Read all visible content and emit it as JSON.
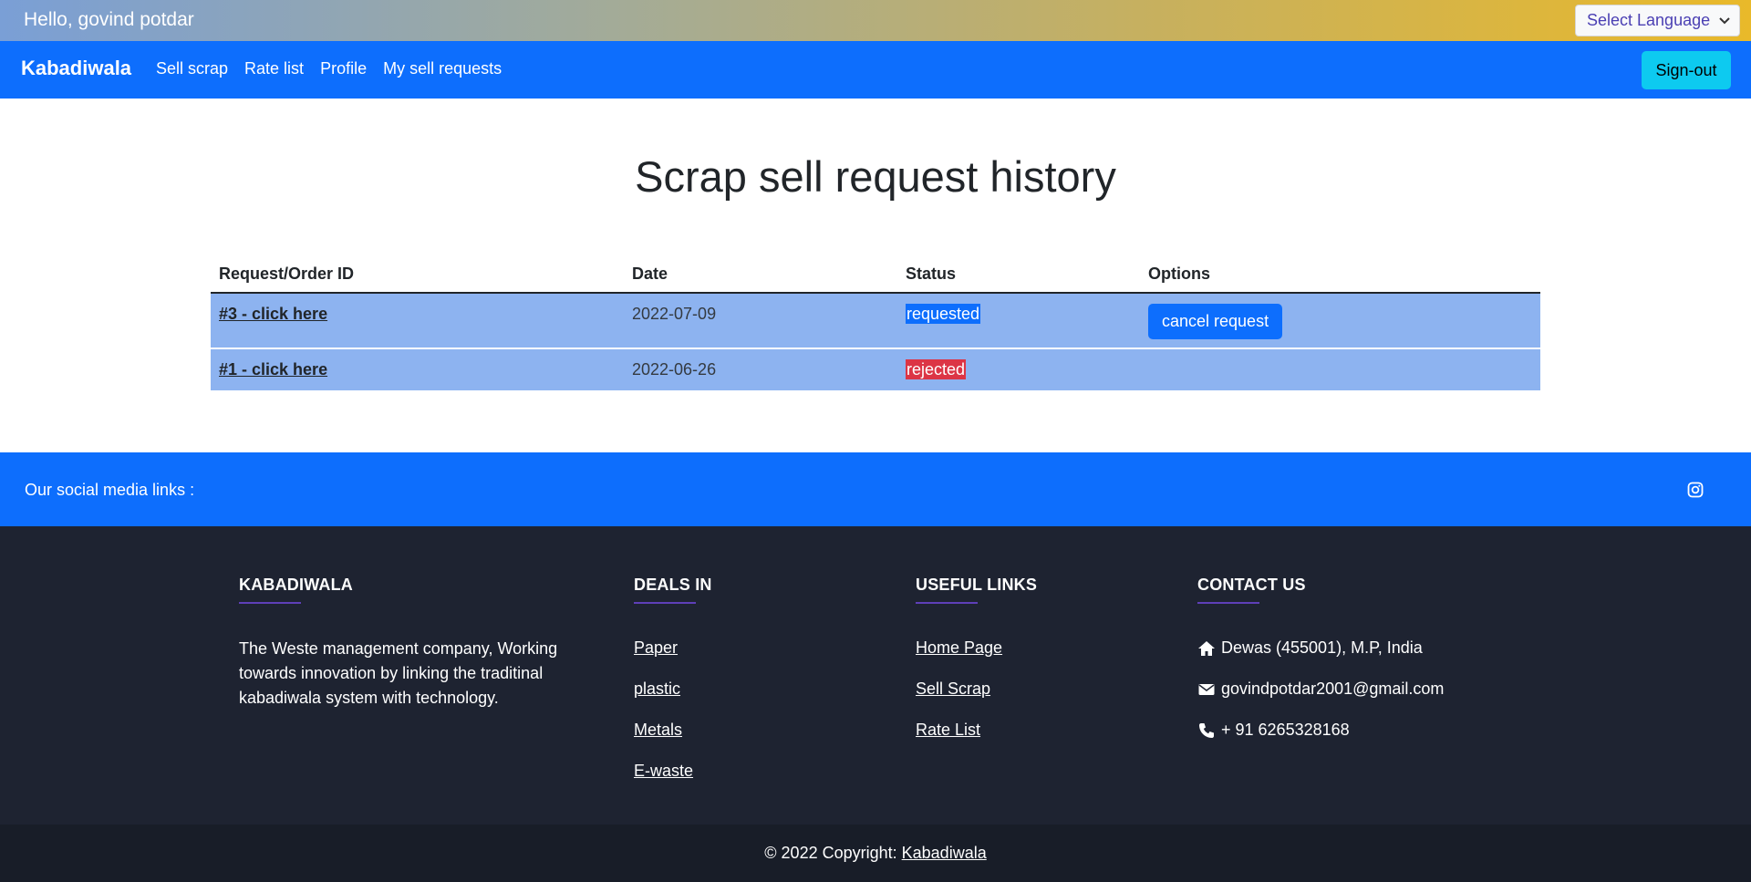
{
  "greeting": "Hello, govind potdar",
  "language_select": {
    "value": "Select Language"
  },
  "navbar": {
    "brand": "Kabadiwala",
    "links": [
      "Sell scrap",
      "Rate list",
      "Profile",
      "My sell requests"
    ],
    "signout_label": "Sign-out"
  },
  "main": {
    "title": "Scrap sell request history",
    "table": {
      "headers": [
        "Request/Order ID",
        "Date",
        "Status",
        "Options"
      ],
      "rows": [
        {
          "id": "#3 - click here",
          "date": "2022-07-09",
          "status": "requested",
          "option": "cancel request"
        },
        {
          "id": "#1 - click here",
          "date": "2022-06-26",
          "status": "rejected",
          "option": ""
        }
      ]
    }
  },
  "social": {
    "label": "Our social media links :",
    "icons": [
      "instagram-icon"
    ]
  },
  "footer": {
    "about": {
      "heading": "KABADIWALA",
      "text": "The Weste management company, Working towards innovation by linking the traditinal kabadiwala system with technology."
    },
    "deals": {
      "heading": "DEALS IN",
      "items": [
        "Paper",
        "plastic",
        "Metals",
        "E-waste"
      ]
    },
    "useful": {
      "heading": "USEFUL LINKS",
      "items": [
        "Home Page",
        "Sell Scrap",
        "Rate List"
      ]
    },
    "contact": {
      "heading": "CONTACT US",
      "address": "Dewas (455001), M.P, India",
      "email": "govindpotdar2001@gmail.com",
      "phone": "+ 91 6265328168"
    },
    "copyright_prefix": "© 2022 Copyright: ",
    "copyright_link": "Kabadiwala"
  },
  "colors": {
    "primary": "#0d6efd",
    "info": "#0dcaf0",
    "danger": "#dc3545",
    "row_bg": "#8db3f0",
    "footer_bg": "#1e2331"
  }
}
